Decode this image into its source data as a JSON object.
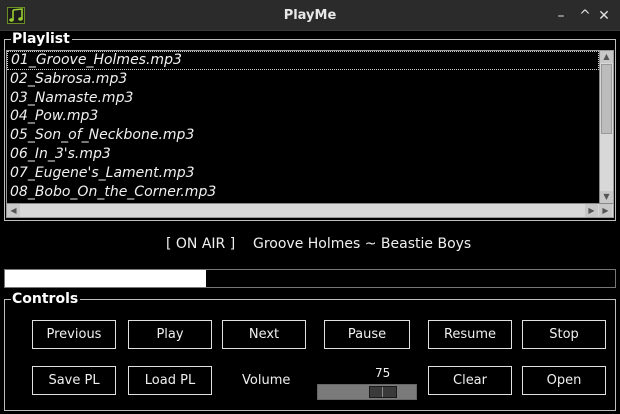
{
  "window": {
    "title": "PlayMe",
    "minimize_glyph": "–",
    "maximize_glyph": "^",
    "close_glyph": "✕",
    "app_icon": "music-note-icon"
  },
  "playlist": {
    "label": "Playlist",
    "items": [
      "01_Groove_Holmes.mp3",
      "02_Sabrosa.mp3",
      "03_Namaste.mp3",
      "04_Pow.mp3",
      "05_Son_of_Neckbone.mp3",
      "06_In_3's.mp3",
      "07_Eugene's_Lament.mp3",
      "08_Bobo_On_the_Corner.mp3"
    ],
    "selected_index": 0
  },
  "now_playing": {
    "status": "[ ON AIR ]",
    "track": "Groove Holmes ~ Beastie Boys"
  },
  "progress": {
    "fraction": 0.33
  },
  "controls": {
    "label": "Controls",
    "previous": "Previous",
    "play": "Play",
    "next": "Next",
    "pause": "Pause",
    "resume": "Resume",
    "stop": "Stop",
    "save_pl": "Save PL",
    "load_pl": "Load PL",
    "volume_label": "Volume",
    "volume_value": "75",
    "volume_level": 75,
    "clear": "Clear",
    "open": "Open"
  }
}
